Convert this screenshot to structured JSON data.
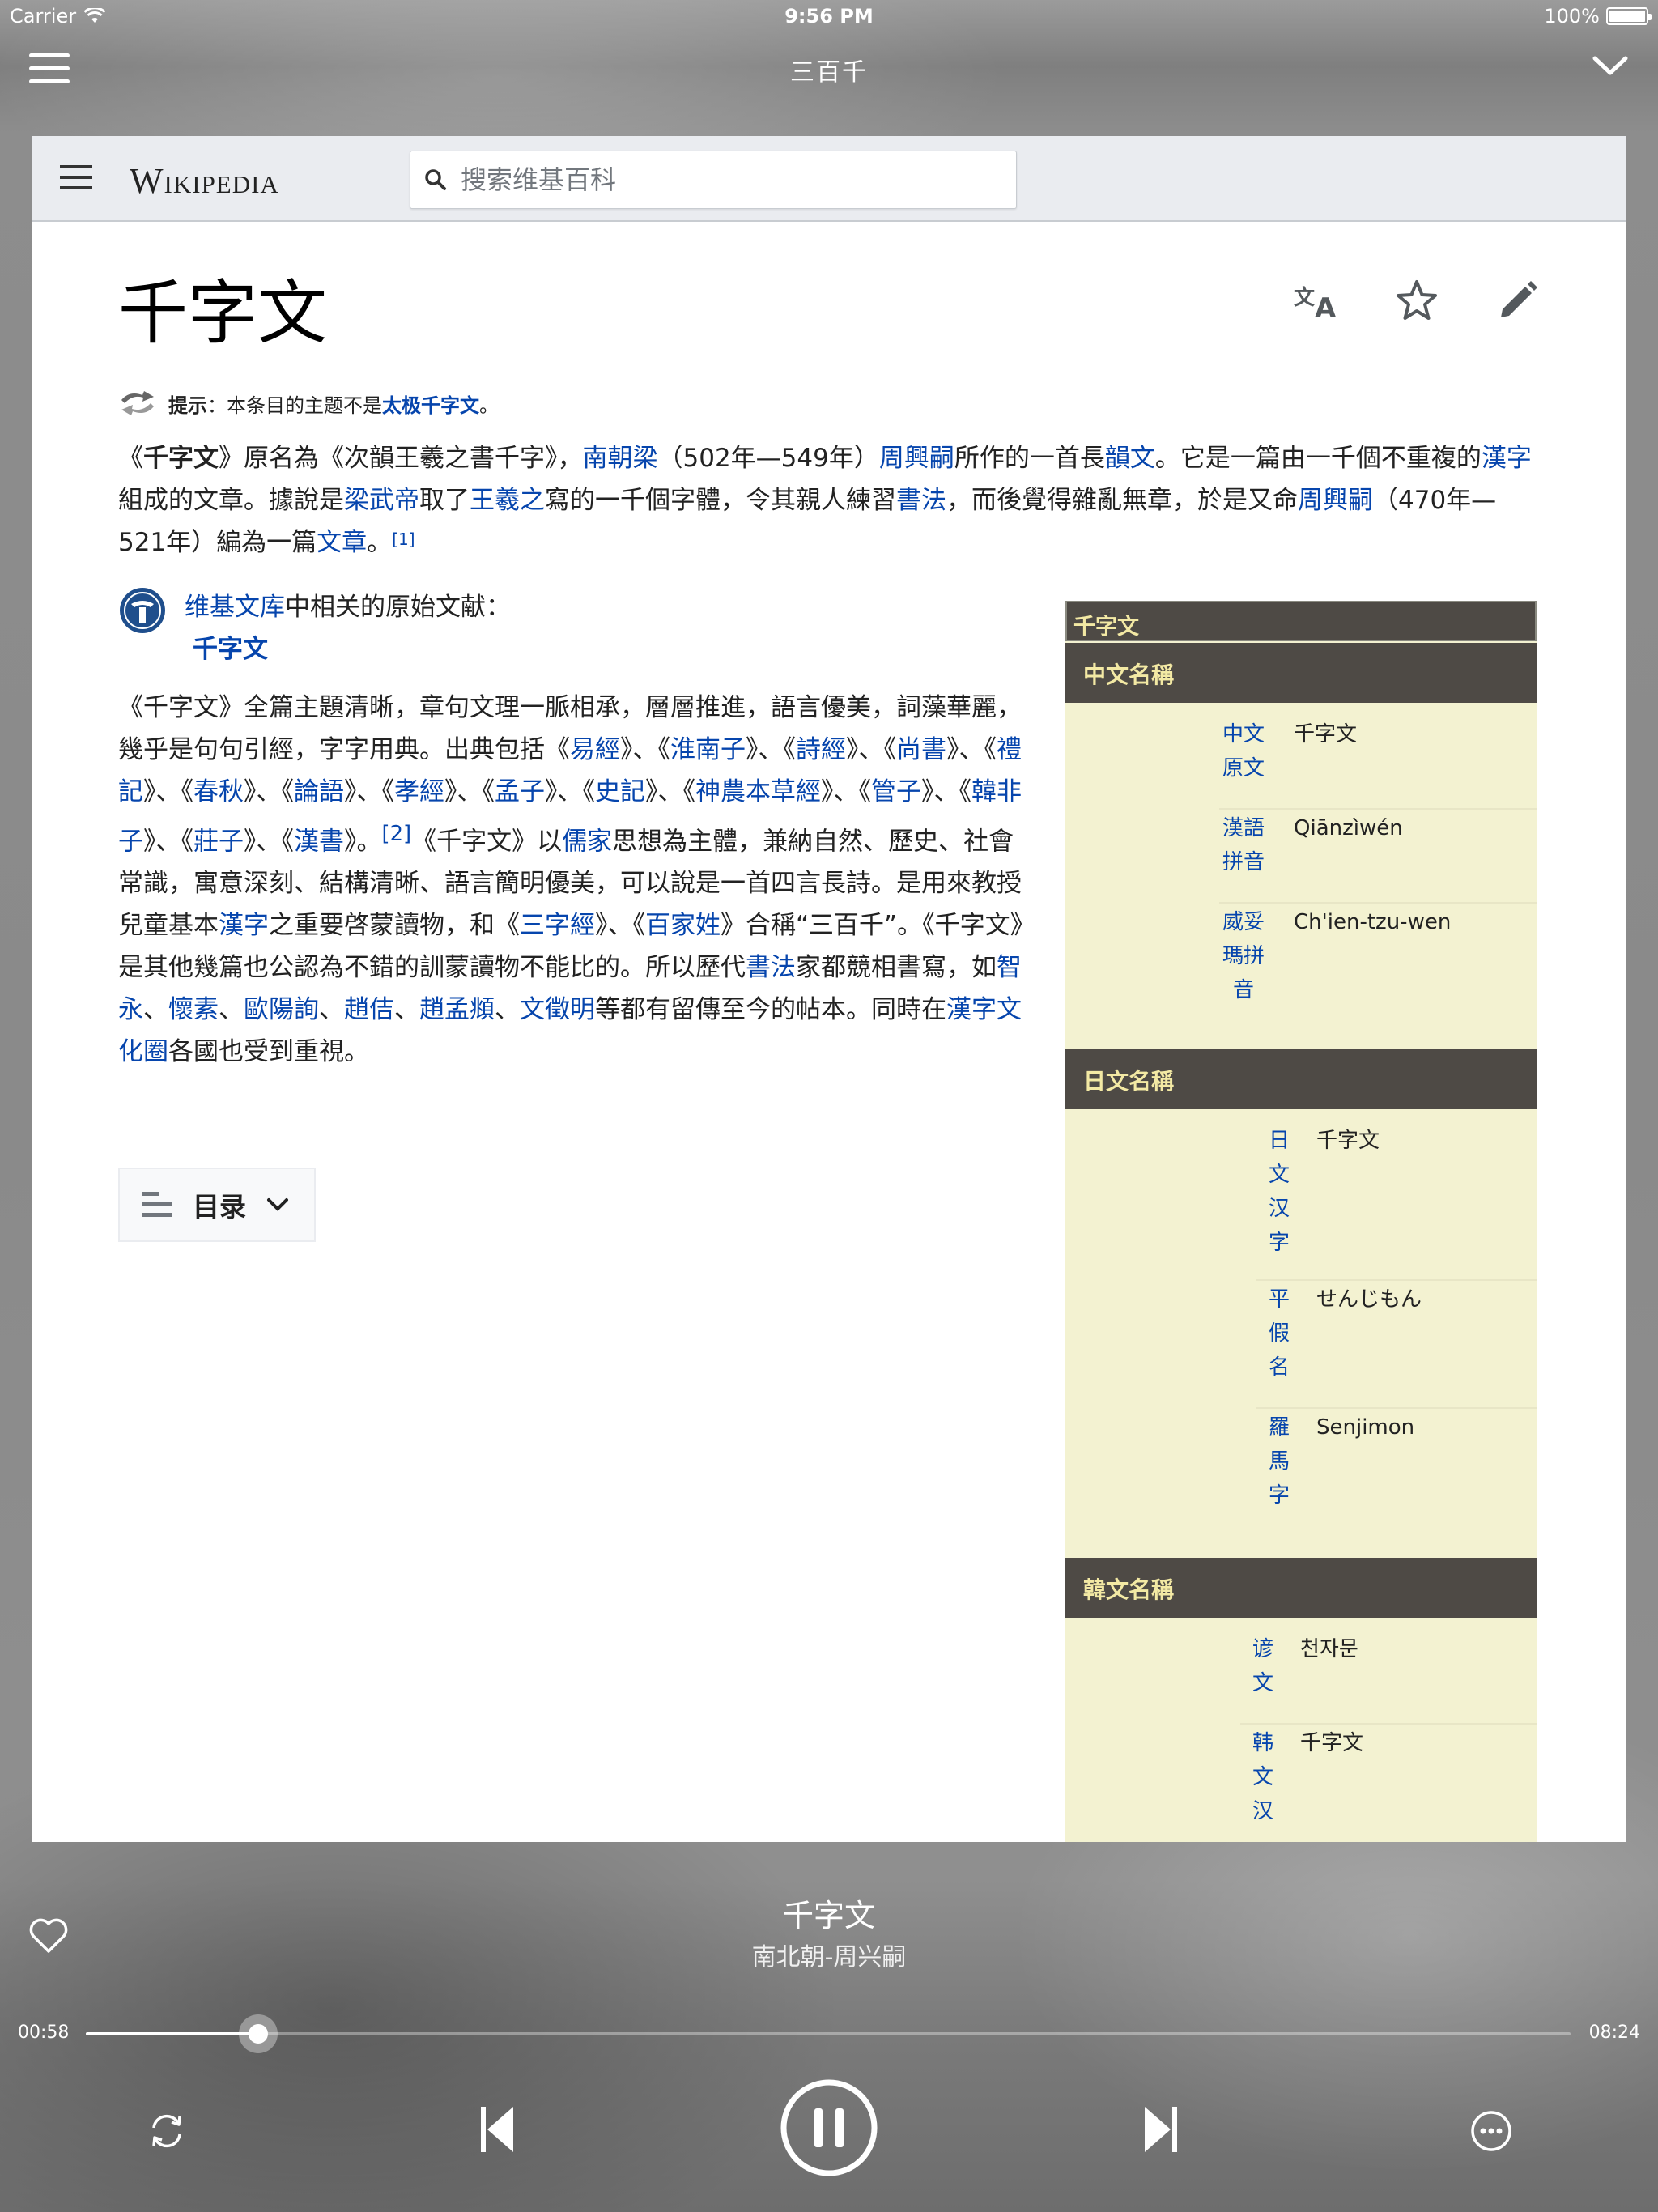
{
  "status_bar": {
    "carrier": "Carrier",
    "time": "9:56 PM",
    "battery": "100%"
  },
  "nav": {
    "title": "三百千"
  },
  "wiki": {
    "wordmark": "Wikipedia",
    "search_placeholder": "搜索维基百科",
    "page_title": "千字文",
    "hatnote": {
      "label": "提示",
      "text": "：本条目的主题不是",
      "link": "太极千字文",
      "end": "。"
    },
    "wikisource": {
      "link": "维基文库",
      "text": "中相关的原始文献：",
      "work": "千字文"
    },
    "toc_label": "目录"
  },
  "infobox": {
    "title": "千字文",
    "sections": [
      {
        "heading": "中文名稱",
        "rows": [
          {
            "label": "中文 原文",
            "value": "千字文"
          },
          {
            "label": "漢語 拼音",
            "value": "Qiānzìwén"
          },
          {
            "label": "威妥 瑪拼 音",
            "value": "Ch'ien-tzu-wen"
          }
        ]
      },
      {
        "heading": "日文名稱",
        "rows": [
          {
            "label": "日 文 汉 字",
            "value": "千字文"
          },
          {
            "label": "平 假 名",
            "value": "せんじもん"
          },
          {
            "label": "羅 馬 字",
            "value": "Senjimon"
          }
        ]
      },
      {
        "heading": "韓文名稱",
        "rows": [
          {
            "label": "谚 文",
            "value": "천자문"
          },
          {
            "label": "韩 文 汉",
            "value": "千字文"
          }
        ]
      }
    ]
  },
  "player": {
    "song_title": "千字文",
    "artist": "南北朝-周兴嗣",
    "current_time": "00:58",
    "total_time": "08:24",
    "progress": 0.116
  },
  "colors": {
    "link": "#0645ad",
    "infobox_header": "#4e4a45",
    "infobox_bg": "#f3f2d1",
    "infobox_header_text": "#f3e9a4"
  },
  "icons": [
    "wifi-icon",
    "battery-icon",
    "menu-icon",
    "chevron-down-icon",
    "search-icon",
    "translate-icon",
    "star-icon",
    "pencil-icon",
    "disambiguation-icon",
    "wikisource-logo",
    "toc-icon",
    "heart-icon",
    "repeat-icon",
    "previous-icon",
    "pause-icon",
    "next-icon",
    "more-icon"
  ]
}
